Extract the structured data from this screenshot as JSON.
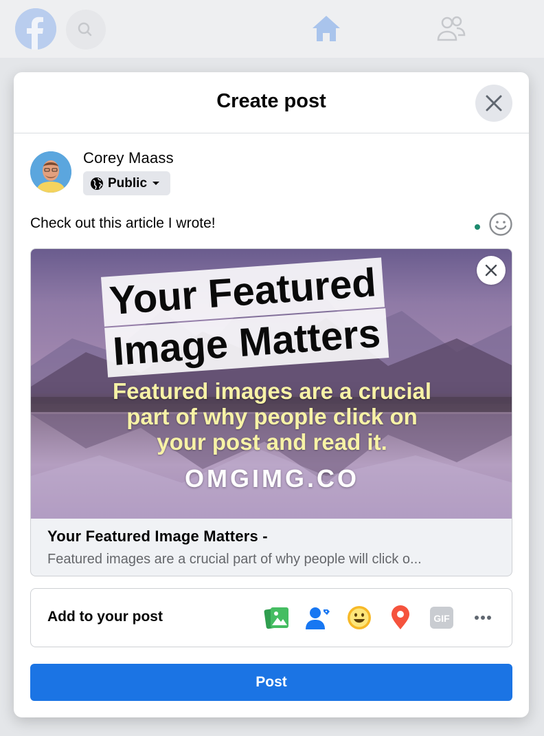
{
  "modal": {
    "title": "Create post"
  },
  "author": {
    "name": "Corey Maass",
    "audience": "Public"
  },
  "post": {
    "text": "Check out this article I wrote!"
  },
  "link_preview": {
    "image_headline_line1": "Your Featured",
    "image_headline_line2": "Image Matters",
    "image_subtext_line1": "Featured images are a crucial",
    "image_subtext_line2": "part of why people click on",
    "image_subtext_line3": "your post and read it.",
    "image_brand": "OMGIMG.CO",
    "title": "Your Featured Image Matters -",
    "description": "Featured images are a crucial part of why people will click o..."
  },
  "add_to_post": {
    "label": "Add to your post",
    "icons": [
      "photo-video-icon",
      "tag-people-icon",
      "feeling-icon",
      "check-in-icon",
      "gif-icon",
      "more-icon"
    ]
  },
  "actions": {
    "post_label": "Post"
  },
  "colors": {
    "primary": "#1b74e4",
    "photo_green": "#45bd62",
    "tag_blue": "#1877f2",
    "feeling_yellow": "#f7b928",
    "checkin_red": "#f5533d",
    "gif_gray": "#c9ccd1"
  }
}
